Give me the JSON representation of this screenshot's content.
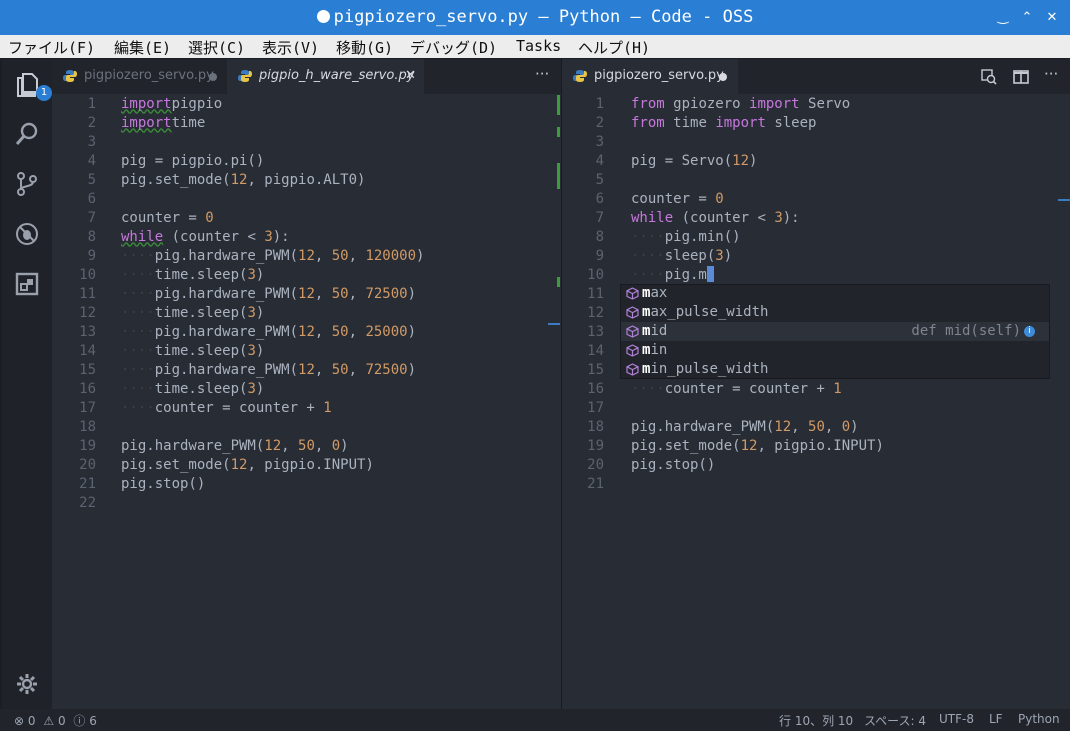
{
  "window": {
    "title": "pigpiozero_servo.py — Python — Code - OSS",
    "minimize": "‿",
    "maximize": "⌃",
    "close": "✕"
  },
  "menu": [
    "ファイル(F)",
    "編集(E)",
    "選択(C)",
    "表示(V)",
    "移動(G)",
    "デバッグ(D)",
    "Tasks",
    "ヘルプ(H)"
  ],
  "activity": {
    "explorer_badge": "1"
  },
  "left_group": {
    "tabs": [
      {
        "label": "pigpiozero_servo.py",
        "state": "inactive",
        "marker": "dot"
      },
      {
        "label": "pigpio_h_ware_servo.py",
        "state": "active",
        "marker": "close"
      }
    ],
    "more": "···",
    "lines": [
      {
        "n": "1",
        "tokens": [
          [
            "kw",
            "import"
          ],
          [
            "",
            "pigpio"
          ]
        ]
      },
      {
        "n": "2",
        "tokens": [
          [
            "kw",
            "import"
          ],
          [
            "",
            "time"
          ]
        ]
      },
      {
        "n": "3",
        "tokens": []
      },
      {
        "n": "4",
        "tokens": [
          [
            "",
            "pig = pigpio.pi()"
          ]
        ]
      },
      {
        "n": "5",
        "tokens": [
          [
            "",
            "pig.set_mode("
          ],
          [
            "num",
            "12"
          ],
          [
            "",
            ", pigpio.ALT0)"
          ]
        ]
      },
      {
        "n": "6",
        "tokens": []
      },
      {
        "n": "7",
        "tokens": [
          [
            "",
            "counter = "
          ],
          [
            "num",
            "0"
          ]
        ]
      },
      {
        "n": "8",
        "tokens": [
          [
            "kw",
            "while"
          ],
          [
            "",
            ""
          ],
          [
            "",
            "(counter < "
          ],
          [
            "num",
            "3"
          ],
          [
            "",
            "):"
          ]
        ]
      },
      {
        "n": "9",
        "tokens": [
          [
            "ws",
            "····"
          ],
          [
            "",
            "pig.hardware_PWM("
          ],
          [
            "num",
            "12"
          ],
          [
            "",
            ", "
          ],
          [
            "num",
            "50"
          ],
          [
            "",
            ", "
          ],
          [
            "num",
            "120000"
          ],
          [
            "",
            ")"
          ]
        ]
      },
      {
        "n": "10",
        "tokens": [
          [
            "ws",
            "····"
          ],
          [
            "",
            "time.sleep("
          ],
          [
            "num",
            "3"
          ],
          [
            "",
            ")"
          ]
        ]
      },
      {
        "n": "11",
        "tokens": [
          [
            "ws",
            "····"
          ],
          [
            "",
            "pig.hardware_PWM("
          ],
          [
            "num",
            "12"
          ],
          [
            "",
            ", "
          ],
          [
            "num",
            "50"
          ],
          [
            "",
            ", "
          ],
          [
            "num",
            "72500"
          ],
          [
            "",
            ")"
          ]
        ]
      },
      {
        "n": "12",
        "tokens": [
          [
            "ws",
            "····"
          ],
          [
            "",
            "time.sleep("
          ],
          [
            "num",
            "3"
          ],
          [
            "",
            ")"
          ]
        ]
      },
      {
        "n": "13",
        "tokens": [
          [
            "ws",
            "····"
          ],
          [
            "",
            "pig.hardware_PWM("
          ],
          [
            "num",
            "12"
          ],
          [
            "",
            ", "
          ],
          [
            "num",
            "50"
          ],
          [
            "",
            ", "
          ],
          [
            "num",
            "25000"
          ],
          [
            "",
            ")"
          ]
        ]
      },
      {
        "n": "14",
        "tokens": [
          [
            "ws",
            "····"
          ],
          [
            "",
            "time.sleep("
          ],
          [
            "num",
            "3"
          ],
          [
            "",
            ")"
          ]
        ]
      },
      {
        "n": "15",
        "tokens": [
          [
            "ws",
            "····"
          ],
          [
            "",
            "pig.hardware_PWM("
          ],
          [
            "num",
            "12"
          ],
          [
            "",
            ", "
          ],
          [
            "num",
            "50"
          ],
          [
            "",
            ", "
          ],
          [
            "num",
            "72500"
          ],
          [
            "",
            ")"
          ]
        ]
      },
      {
        "n": "16",
        "tokens": [
          [
            "ws",
            "····"
          ],
          [
            "",
            "time.sleep("
          ],
          [
            "num",
            "3"
          ],
          [
            "",
            ")"
          ]
        ]
      },
      {
        "n": "17",
        "tokens": [
          [
            "ws",
            "····"
          ],
          [
            "",
            "counter = counter + "
          ],
          [
            "num",
            "1"
          ]
        ]
      },
      {
        "n": "18",
        "tokens": []
      },
      {
        "n": "19",
        "tokens": [
          [
            "",
            "pig.hardware_PWM("
          ],
          [
            "num",
            "12"
          ],
          [
            "",
            ", "
          ],
          [
            "num",
            "50"
          ],
          [
            "",
            ", "
          ],
          [
            "num",
            "0"
          ],
          [
            "",
            ")"
          ]
        ]
      },
      {
        "n": "20",
        "tokens": [
          [
            "",
            "pig.set_mode("
          ],
          [
            "num",
            "12"
          ],
          [
            "",
            ", pigpio.INPUT)"
          ]
        ]
      },
      {
        "n": "21",
        "tokens": [
          [
            "",
            "pig.stop()"
          ]
        ]
      },
      {
        "n": "22",
        "tokens": []
      }
    ]
  },
  "right_group": {
    "tabs": [
      {
        "label": "pigpiozero_servo.py",
        "state": "active",
        "marker": "dot"
      }
    ],
    "lines": [
      {
        "n": "1",
        "tokens": [
          [
            "kw",
            "from"
          ],
          [
            "",
            ""
          ],
          [
            "",
            "gpiozero "
          ],
          [
            "kw",
            "import"
          ],
          [
            "",
            ""
          ],
          [
            "",
            "Servo"
          ]
        ]
      },
      {
        "n": "2",
        "tokens": [
          [
            "kw",
            "from"
          ],
          [
            "",
            ""
          ],
          [
            "",
            "time "
          ],
          [
            "kw",
            "import"
          ],
          [
            "",
            ""
          ],
          [
            "",
            "sleep"
          ]
        ]
      },
      {
        "n": "3",
        "tokens": []
      },
      {
        "n": "4",
        "tokens": [
          [
            "",
            "pig = Servo("
          ],
          [
            "num",
            "12"
          ],
          [
            "",
            ")"
          ]
        ]
      },
      {
        "n": "5",
        "tokens": []
      },
      {
        "n": "6",
        "tokens": [
          [
            "",
            "counter = "
          ],
          [
            "num",
            "0"
          ]
        ]
      },
      {
        "n": "7",
        "tokens": [
          [
            "kw",
            "while"
          ],
          [
            "",
            ""
          ],
          [
            "",
            "(counter < "
          ],
          [
            "num",
            "3"
          ],
          [
            "",
            "):"
          ]
        ]
      },
      {
        "n": "8",
        "tokens": [
          [
            "ws",
            "····"
          ],
          [
            "",
            "pig.min()"
          ]
        ]
      },
      {
        "n": "9",
        "tokens": [
          [
            "ws",
            "····"
          ],
          [
            "",
            "sleep("
          ],
          [
            "num",
            "3"
          ],
          [
            "",
            ")"
          ]
        ]
      },
      {
        "n": "10",
        "tokens": [
          [
            "ws",
            "····"
          ],
          [
            "",
            "pig.m"
          ]
        ]
      },
      {
        "n": "11",
        "tokens": []
      },
      {
        "n": "12",
        "tokens": []
      },
      {
        "n": "13",
        "tokens": []
      },
      {
        "n": "14",
        "tokens": []
      },
      {
        "n": "15",
        "tokens": []
      },
      {
        "n": "16",
        "tokens": [
          [
            "ws",
            "····"
          ],
          [
            "",
            "counter = counter + "
          ],
          [
            "num",
            "1"
          ]
        ]
      },
      {
        "n": "17",
        "tokens": []
      },
      {
        "n": "18",
        "tokens": [
          [
            "",
            "pig.hardware_PWM("
          ],
          [
            "num",
            "12"
          ],
          [
            "",
            ", "
          ],
          [
            "num",
            "50"
          ],
          [
            "",
            ", "
          ],
          [
            "num",
            "0"
          ],
          [
            "",
            ")"
          ]
        ]
      },
      {
        "n": "19",
        "tokens": [
          [
            "",
            "pig.set_mode("
          ],
          [
            "num",
            "12"
          ],
          [
            "",
            ", pigpio.INPUT)"
          ]
        ]
      },
      {
        "n": "20",
        "tokens": [
          [
            "",
            "pig.stop()"
          ]
        ]
      },
      {
        "n": "21",
        "tokens": []
      }
    ]
  },
  "suggest": {
    "items": [
      {
        "match": "m",
        "rest": "ax",
        "detail": ""
      },
      {
        "match": "m",
        "rest": "ax_pulse_width",
        "detail": ""
      },
      {
        "match": "m",
        "rest": "id",
        "detail": "def mid(self)",
        "selected": true
      },
      {
        "match": "m",
        "rest": "in",
        "detail": ""
      },
      {
        "match": "m",
        "rest": "in_pulse_width",
        "detail": ""
      }
    ],
    "info": "i"
  },
  "status": {
    "errors": "0",
    "warnings": "0",
    "info": "6",
    "position": "行 10、列 10",
    "spaces": "スペース: 4",
    "encoding": "UTF-8",
    "eol": "LF",
    "language": "Python"
  },
  "colors": {
    "titlebar": "#2a7fd4",
    "keyword": "#c678dd",
    "number": "#d19a66",
    "text": "#abb2bf",
    "git_added": "#3c9c3c"
  }
}
